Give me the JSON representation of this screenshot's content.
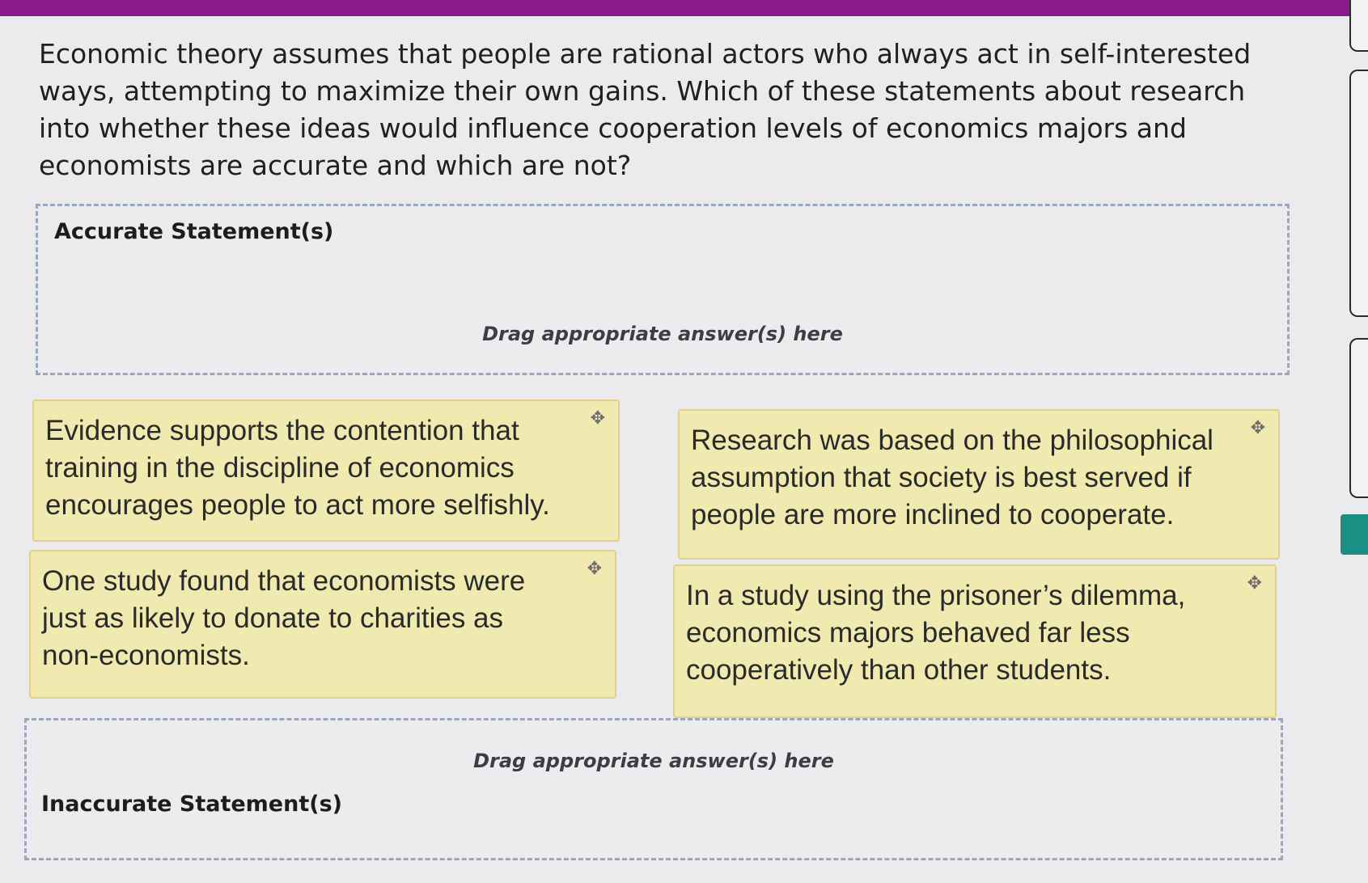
{
  "question": "Economic theory assumes that people are rational actors who always act in self-interested ways, attempting to maximize their own gains. Which of these statements about research into whether these ideas would influence cooperation levels of economics majors and economists are accurate and which are not?",
  "zones": {
    "accurate": {
      "title": "Accurate Statement(s)",
      "hint": "Drag appropriate answer(s) here"
    },
    "inaccurate": {
      "title": "Inaccurate Statement(s)",
      "hint": "Drag appropriate answer(s) here"
    }
  },
  "cards": [
    {
      "text": "Evidence supports the contention that training in the discipline of economics encourages people to act more selfishly.",
      "handle_icon": "move-icon"
    },
    {
      "text": "Research was based on the philosophical assumption that society is best served if people are more inclined to cooperate.",
      "handle_icon": "move-icon"
    },
    {
      "text": "One study found that economists were just as likely to donate to charities as non-economists.",
      "handle_icon": "move-icon"
    },
    {
      "text": "In a study using the prisoner’s dilemma, economics majors behaved far less cooperatively than other students.",
      "handle_icon": "move-icon"
    }
  ],
  "colors": {
    "header_bar": "#8a1a88",
    "card_background": "#f0eab0",
    "dropzone_border": "#9aa7bf",
    "accent_teal": "#1a8f84"
  }
}
